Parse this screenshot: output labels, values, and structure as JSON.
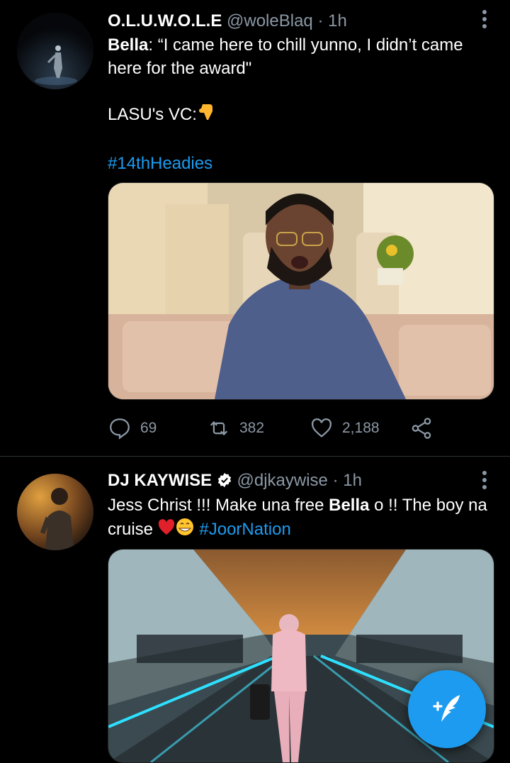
{
  "tweets": [
    {
      "display_name": "O.L.U.W.O.L.E",
      "handle": "@woleBlaq",
      "time": "· 1h",
      "text": {
        "bold_name": "Bella",
        "line1_rest": ": “I came here to chill yunno, I didn’t came here for the award\"",
        "line2": "LASU's VC:",
        "line2_emoji": "pointing-down-emoji",
        "hashtag": "#14thHeadies"
      },
      "media_icon": "video-still-man-on-sofa",
      "replies": "69",
      "retweets": "382",
      "likes": "2,188"
    },
    {
      "display_name": "DJ KAYWISE",
      "verified_icon": "verified-badge-icon",
      "handle": "@djkaywise",
      "time": "· 1h",
      "text": {
        "part1": "Jess Christ !!! Make una free ",
        "bold_name": "Bella",
        "part2": " o !! The boy na cruise",
        "emojis": "heart-and-grin-emoji",
        "hashtag": "#JoorNation"
      },
      "media_icon": "photo-airport-walkway"
    }
  ],
  "fab": {
    "icon": "compose-tweet-icon"
  },
  "colors": {
    "accent": "#1d9bf0",
    "muted": "#8b98a5",
    "background": "#000000"
  }
}
